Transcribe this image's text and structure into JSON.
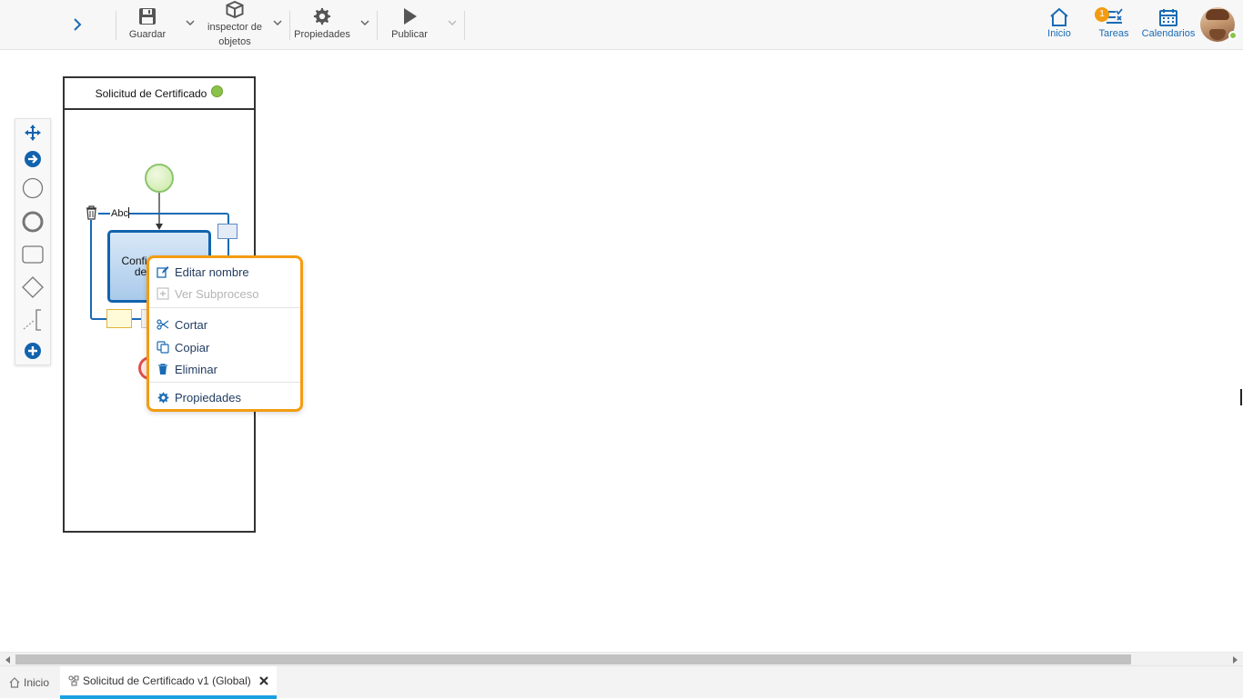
{
  "toolbar": {
    "guardar": "Guardar",
    "inspector_line1": "inspector de",
    "inspector_line2": "objetos",
    "propiedades": "Propiedades",
    "publicar": "Publicar"
  },
  "right_nav": {
    "inicio": "Inicio",
    "tareas": "Tareas",
    "tareas_badge": "1",
    "calendarios": "Calendarios"
  },
  "diagram": {
    "pool_title": "Solicitud de Certificado",
    "label_editor_text": "Abc",
    "task_label_line1": "Confirm",
    "task_label_line2": "de"
  },
  "context_menu": {
    "items": [
      {
        "label": "Editar nombre",
        "icon": "edit-icon"
      },
      {
        "label": "Ver Subproceso",
        "icon": "subprocess-icon",
        "disabled": true
      },
      {
        "label": "Cortar",
        "icon": "scissors-icon"
      },
      {
        "label": "Copiar",
        "icon": "copy-icon"
      },
      {
        "label": "Eliminar",
        "icon": "trash-icon"
      },
      {
        "label": "Propiedades",
        "icon": "gear-icon"
      }
    ]
  },
  "tabs": {
    "home": "Inicio",
    "active": "Solicitud de Certificado v1 (Global)"
  },
  "colors": {
    "accent_blue": "#1a6bb5",
    "menu_border": "#f39c12",
    "status_green": "#8bc34a",
    "active_tab": "#1ba0e2"
  }
}
